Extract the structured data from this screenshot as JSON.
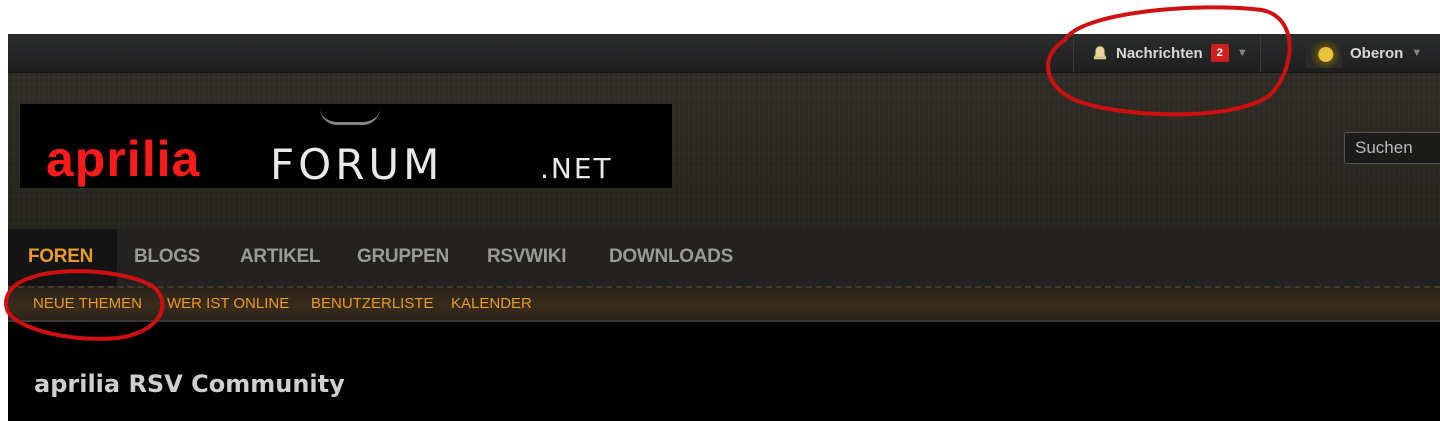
{
  "topbar": {
    "notifications": {
      "label": "Nachrichten",
      "count": "2",
      "caret": "▼",
      "icon": "bell-icon"
    },
    "user": {
      "name": "Oberon",
      "caret": "▼"
    }
  },
  "header": {
    "logo": {
      "text_red": "aprilia",
      "text_forum": "FORUM",
      "text_net": ".NET"
    },
    "search": {
      "placeholder": "Suchen"
    }
  },
  "nav": {
    "tabs": [
      {
        "label": "FOREN",
        "active": true
      },
      {
        "label": "BLOGS"
      },
      {
        "label": "ARTIKEL"
      },
      {
        "label": "GRUPPEN"
      },
      {
        "label": "RSVWIKI"
      },
      {
        "label": "DOWNLOADS"
      }
    ]
  },
  "subnav": {
    "items": [
      {
        "label": "NEUE THEMEN"
      },
      {
        "label": "WER IST ONLINE"
      },
      {
        "label": "BENUTZERLISTE"
      },
      {
        "label": "KALENDER"
      }
    ]
  },
  "page": {
    "title": "aprilia RSV Community"
  },
  "colors": {
    "accent": "#e89a2a",
    "badge": "#d11f1f",
    "annotation": "#d01010"
  }
}
